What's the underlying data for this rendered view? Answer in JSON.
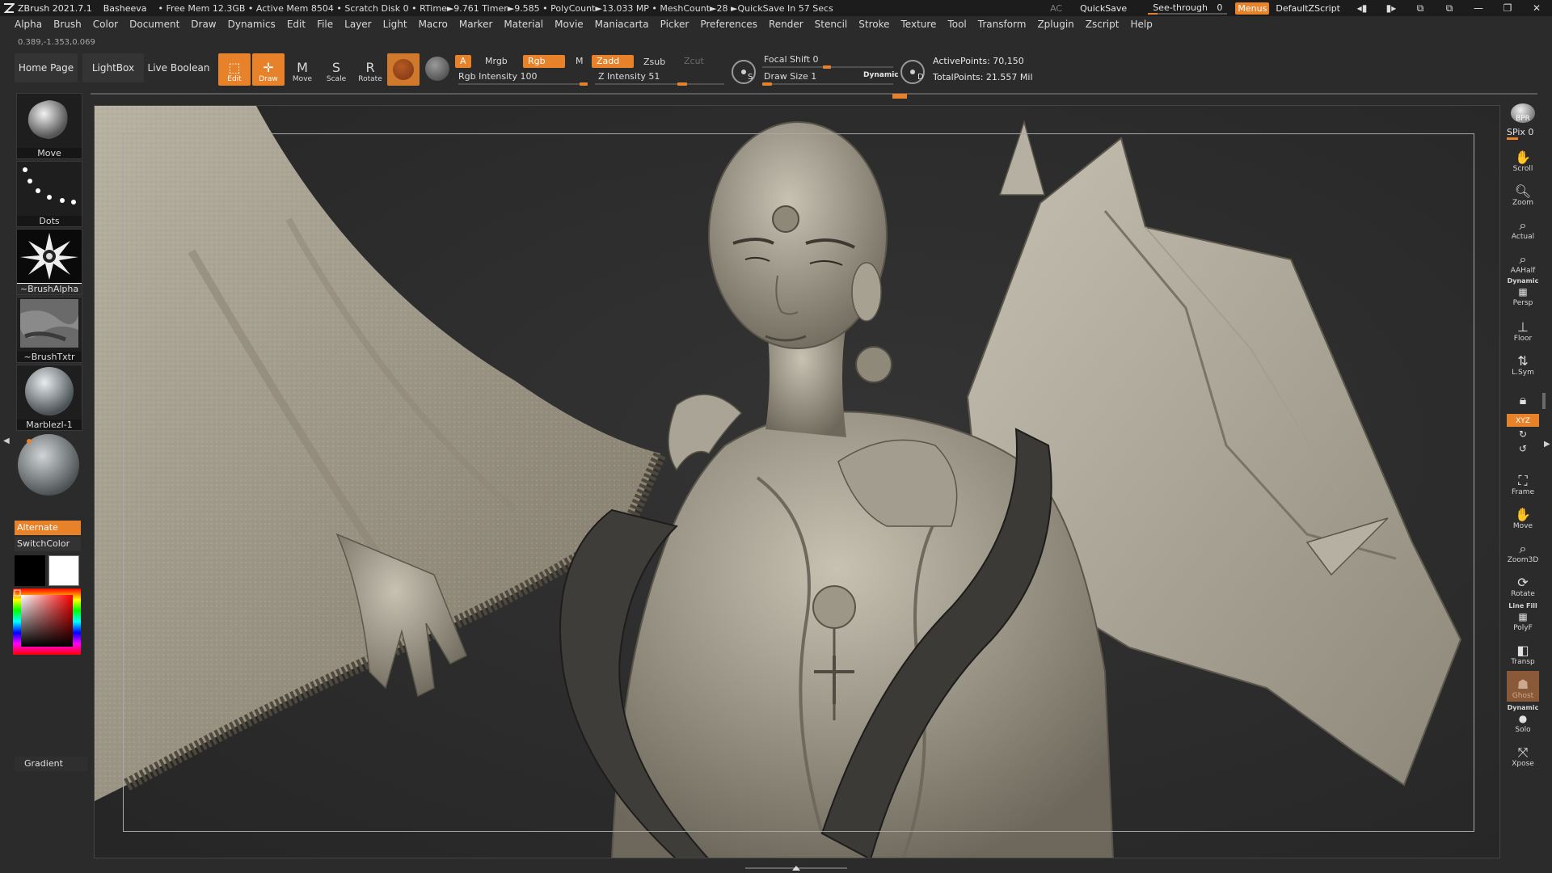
{
  "titlebar": {
    "app": "ZBrush 2021.7.1",
    "doc_name": "Basheeva",
    "stats": "• Free Mem 12.3GB • Active Mem 8504 • Scratch Disk 0 • RTime►9.761 Timer►9.585 • PolyCount►13.033 MP • MeshCount►28 ►QuickSave In 57 Secs",
    "ac": "AC",
    "quicksave": "QuickSave",
    "seethrough": "See-through",
    "seethrough_value": "0",
    "menus": "Menus",
    "script": "DefaultZScript"
  },
  "menu": [
    "Alpha",
    "Brush",
    "Color",
    "Document",
    "Draw",
    "Dynamics",
    "Edit",
    "File",
    "Layer",
    "Light",
    "Macro",
    "Marker",
    "Material",
    "Movie",
    "Maniacarta",
    "Picker",
    "Preferences",
    "Render",
    "Stencil",
    "Stroke",
    "Texture",
    "Tool",
    "Transform",
    "Zplugin",
    "Zscript",
    "Help"
  ],
  "coords": "0.389,-1.353,0.069",
  "toolbar": {
    "home_page": "Home Page",
    "lightbox": "LightBox",
    "live_boolean": "Live Boolean",
    "edit": "Edit",
    "draw": "Draw",
    "move": "Move",
    "scale": "Scale",
    "rotate": "Rotate",
    "a": "A",
    "mrgb": "Mrgb",
    "rgb": "Rgb",
    "m": "M",
    "zadd": "Zadd",
    "zsub": "Zsub",
    "zcut": "Zcut",
    "rgb_intensity": "Rgb Intensity 100",
    "z_intensity": "Z Intensity 51",
    "focal_shift": "Focal Shift 0",
    "draw_size": "Draw Size 1",
    "dynamic": "Dynamic",
    "active_points": "ActivePoints: 70,150",
    "total_points": "TotalPoints: 21.557 Mil",
    "s_label": "S",
    "d_label": "D"
  },
  "leftshelf": {
    "move": "Move",
    "dots": "Dots",
    "brush_alpha": "~BrushAlpha",
    "brush_txtr": "~BrushTxtr",
    "material": "MarblezI-1",
    "alternate": "Alternate",
    "switch_color": "SwitchColor",
    "gradient": "Gradient"
  },
  "rightshelf": {
    "bpr": "BPR",
    "spix": "SPix 0",
    "scroll": "Scroll",
    "zoom": "Zoom",
    "actual": "Actual",
    "aahalf": "AAHalf",
    "dynamic": "Dynamic",
    "persp": "Persp",
    "floor": "Floor",
    "lsym": "L.Sym",
    "xyz": "XYZ",
    "frame": "Frame",
    "move": "Move",
    "zoom3d": "Zoom3D",
    "rotate": "Rotate",
    "linefill": "Line Fill",
    "polyf": "PolyF",
    "transp": "Transp",
    "ghost": "Ghost",
    "solo_dynamic": "Dynamic",
    "solo": "Solo",
    "xpose": "Xpose"
  },
  "colors": {
    "accent": "#e8822a",
    "main_color": "#000000",
    "secondary_color": "#ffffff"
  }
}
